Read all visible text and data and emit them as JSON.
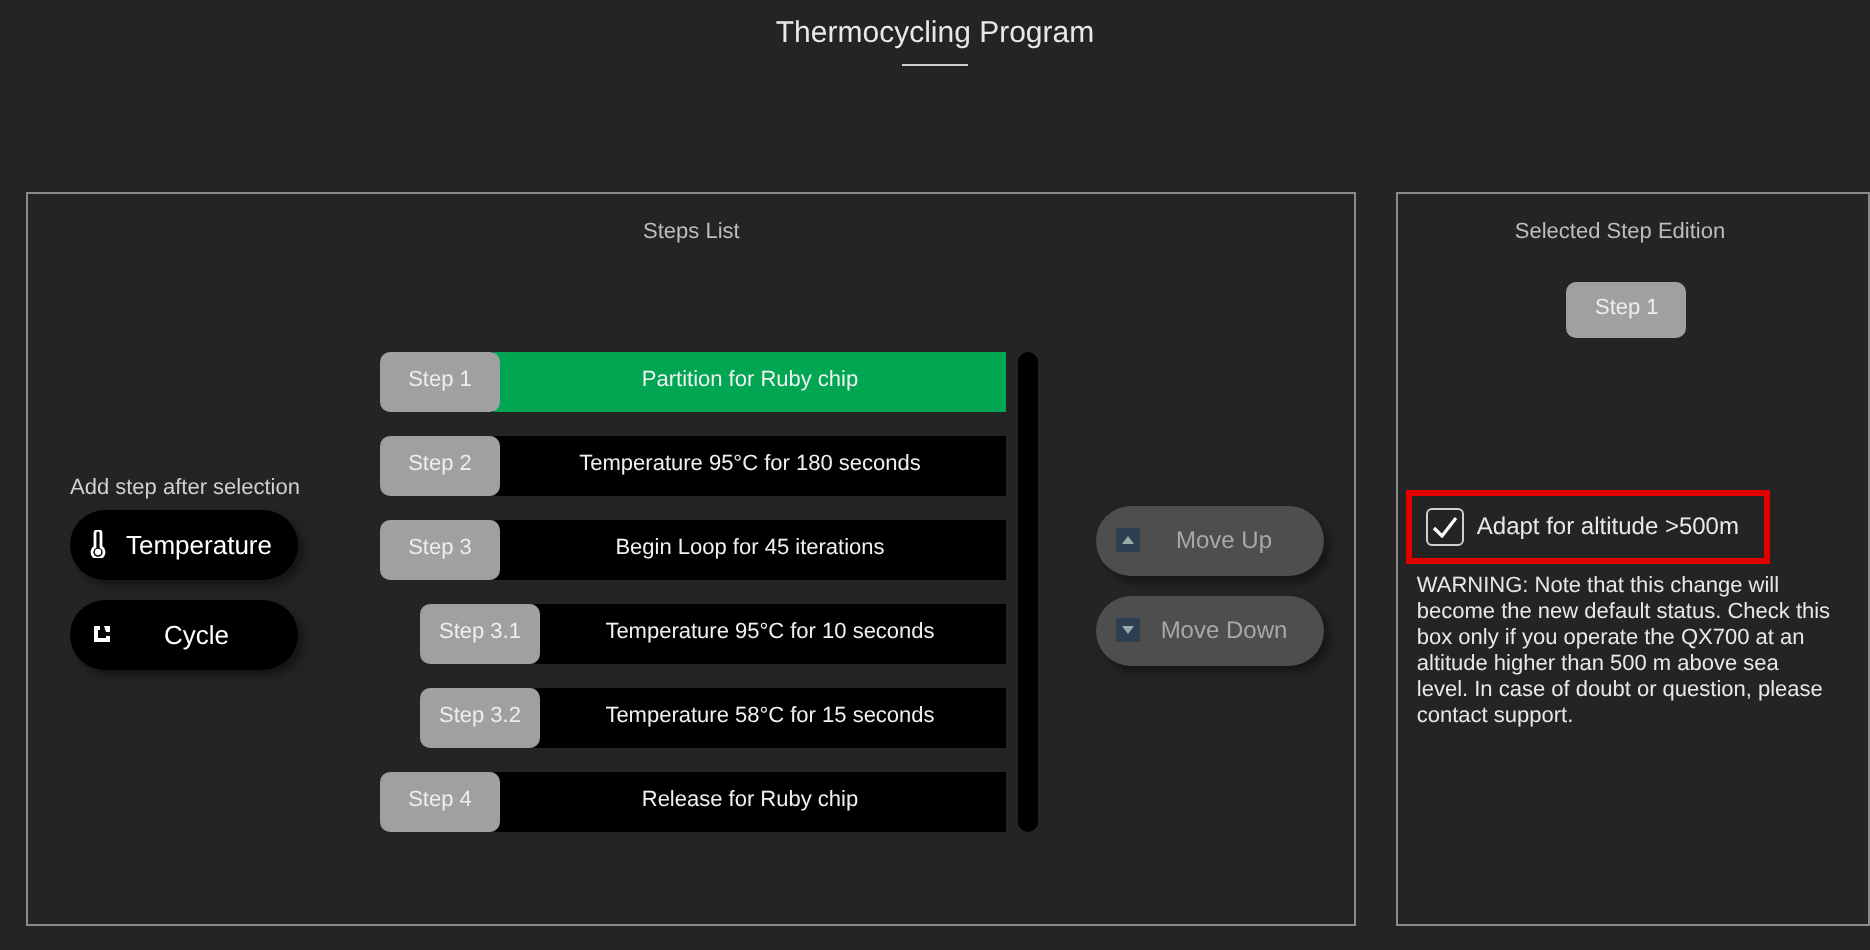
{
  "window": {
    "title": "Thermocycling Program"
  },
  "steps_list": {
    "title": "Steps List",
    "add_step": {
      "label": "Add step after selection",
      "buttons": [
        {
          "kind": "temperature",
          "label": "Temperature"
        },
        {
          "kind": "cycle",
          "label": "Cycle"
        }
      ]
    },
    "steps": [
      {
        "label": "Step 1",
        "description": "Partition for Ruby chip",
        "selected": true
      },
      {
        "label": "Step 2",
        "description": "Temperature 95°C for 180 seconds",
        "selected": false
      },
      {
        "label": "Step 3",
        "description": "Begin Loop for 45 iterations",
        "selected": false,
        "children": [
          {
            "label": "Step 3.1",
            "description": "Temperature 95°C for 10 seconds",
            "selected": false
          },
          {
            "label": "Step 3.2",
            "description": "Temperature 58°C for 15 seconds",
            "selected": false
          }
        ]
      },
      {
        "label": "Step 4",
        "description": "Release for Ruby chip",
        "selected": false
      }
    ],
    "move_buttons": [
      {
        "kind": "up",
        "label": "Move Up",
        "disabled": true
      },
      {
        "kind": "down",
        "label": "Move Down",
        "disabled": true
      }
    ]
  },
  "step_edition": {
    "title": "Selected Step Edition",
    "step": "Step 1",
    "altitude": {
      "label": "Adapt for altitude >500m",
      "checked": true
    },
    "warning": "WARNING: Note that this change will become the new default status. Check this box only if you operate the QX700 at an altitude higher than 500 m above sea level. In case of doubt or question, please contact support."
  }
}
